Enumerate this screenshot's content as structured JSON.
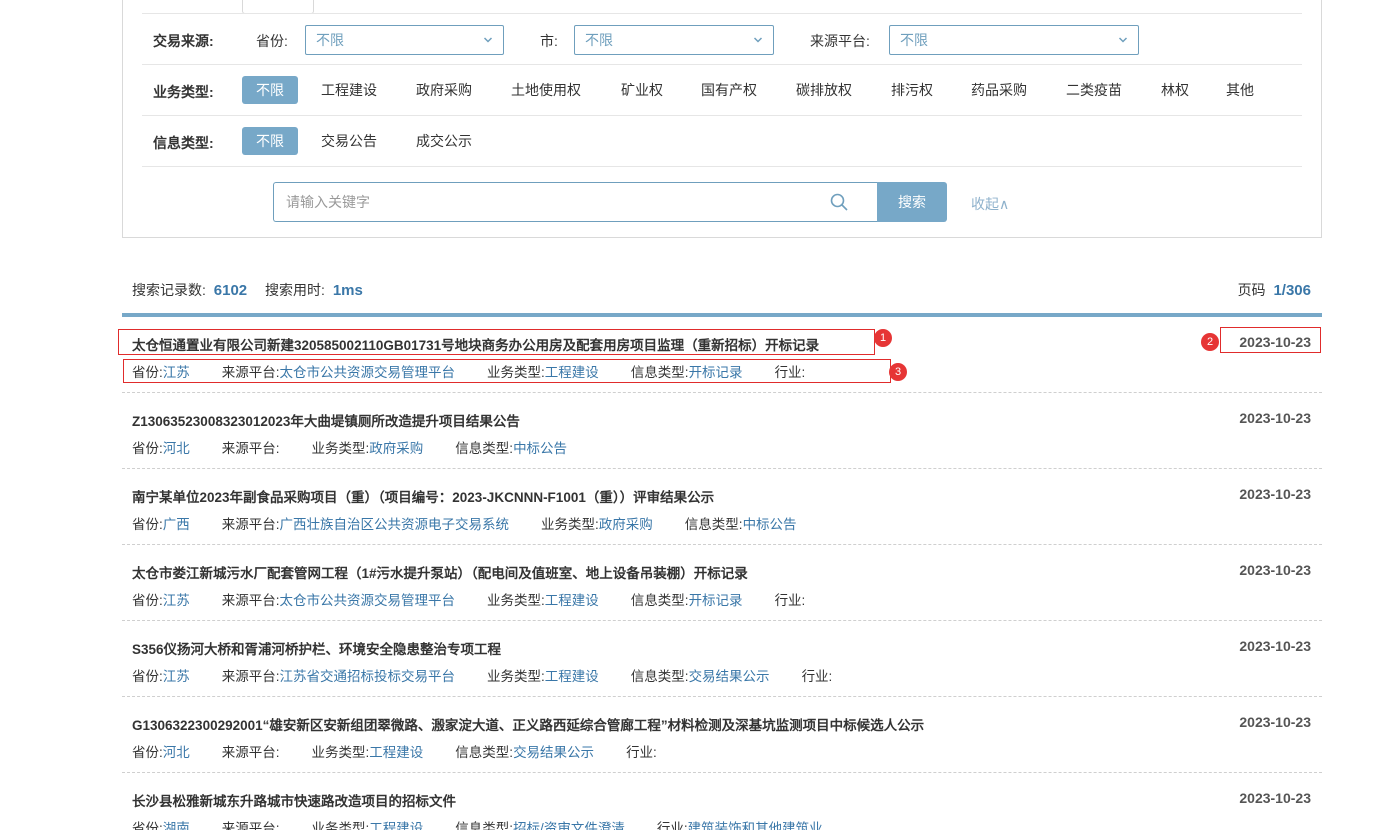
{
  "filters": {
    "source_label": "交易来源:",
    "province_label": "省份:",
    "province_value": "不限",
    "city_label": "市:",
    "city_value": "不限",
    "platform_label": "来源平台:",
    "platform_value": "不限",
    "business_label": "业务类型:",
    "business_options": [
      "不限",
      "工程建设",
      "政府采购",
      "土地使用权",
      "矿业权",
      "国有产权",
      "碳排放权",
      "排污权",
      "药品采购",
      "二类疫苗",
      "林权",
      "其他"
    ],
    "info_label": "信息类型:",
    "info_options": [
      "不限",
      "交易公告",
      "成交公示"
    ]
  },
  "search": {
    "placeholder": "请输入关键字",
    "button_label": "搜索",
    "collapse_label": "收起∧"
  },
  "summary": {
    "count_label": "搜索记录数:",
    "count_value": "6102",
    "time_label": "搜索用时:",
    "time_value": "1ms",
    "page_label": "页码",
    "page_value": "1/306"
  },
  "results": [
    {
      "title": "太仓恒通置业有限公司新建320585002110GB01731号地块商务办公用房及配套用房项目监理（重新招标）开标记录",
      "date": "2023-10-23",
      "meta": [
        [
          "省份:",
          "江苏"
        ],
        [
          "来源平台:",
          "太仓市公共资源交易管理平台"
        ],
        [
          "业务类型:",
          "工程建设"
        ],
        [
          "信息类型:",
          "开标记录"
        ],
        [
          "行业:",
          ""
        ]
      ]
    },
    {
      "title": "Z13063523008323012023年大曲堤镇厕所改造提升项目结果公告",
      "date": "2023-10-23",
      "meta": [
        [
          "省份:",
          "河北"
        ],
        [
          "来源平台:",
          ""
        ],
        [
          "业务类型:",
          "政府采购"
        ],
        [
          "信息类型:",
          "中标公告"
        ]
      ]
    },
    {
      "title": "南宁某单位2023年副食品采购项目（重）（项目编号：2023-JKCNNN-F1001（重））评审结果公示",
      "date": "2023-10-23",
      "meta": [
        [
          "省份:",
          "广西"
        ],
        [
          "来源平台:",
          "广西壮族自治区公共资源电子交易系统"
        ],
        [
          "业务类型:",
          "政府采购"
        ],
        [
          "信息类型:",
          "中标公告"
        ]
      ]
    },
    {
      "title": "太仓市娄江新城污水厂配套管网工程（1#污水提升泵站）（配电间及值班室、地上设备吊装棚）开标记录",
      "date": "2023-10-23",
      "meta": [
        [
          "省份:",
          "江苏"
        ],
        [
          "来源平台:",
          "太仓市公共资源交易管理平台"
        ],
        [
          "业务类型:",
          "工程建设"
        ],
        [
          "信息类型:",
          "开标记录"
        ],
        [
          "行业:",
          ""
        ]
      ]
    },
    {
      "title": "S356仪扬河大桥和胥浦河桥护栏、环境安全隐患整治专项工程",
      "date": "2023-10-23",
      "meta": [
        [
          "省份:",
          "江苏"
        ],
        [
          "来源平台:",
          "江苏省交通招标投标交易平台"
        ],
        [
          "业务类型:",
          "工程建设"
        ],
        [
          "信息类型:",
          "交易结果公示"
        ],
        [
          "行业:",
          ""
        ]
      ]
    },
    {
      "title": "G1306322300292001“雄安新区安新组团翠微路、溵家淀大道、正义路西延综合管廊工程”材料检测及深基坑监测项目中标候选人公示",
      "date": "2023-10-23",
      "meta": [
        [
          "省份:",
          "河北"
        ],
        [
          "来源平台:",
          ""
        ],
        [
          "业务类型:",
          "工程建设"
        ],
        [
          "信息类型:",
          "交易结果公示"
        ],
        [
          "行业:",
          ""
        ]
      ]
    },
    {
      "title": "长沙县松雅新城东升路城市快速路改造项目的招标文件",
      "date": "2023-10-23",
      "meta": [
        [
          "省份:",
          "湖南"
        ],
        [
          "来源平台:",
          ""
        ],
        [
          "业务类型:",
          "工程建设"
        ],
        [
          "信息类型:",
          "招标/资审文件澄清"
        ],
        [
          "行业:",
          "建筑装饰和其他建筑业"
        ]
      ]
    }
  ],
  "annotations": [
    "1",
    "2",
    "3"
  ],
  "colors": {
    "accent": "#77a8c8",
    "link": "#3a77a8",
    "annotation": "#e02c2c"
  }
}
